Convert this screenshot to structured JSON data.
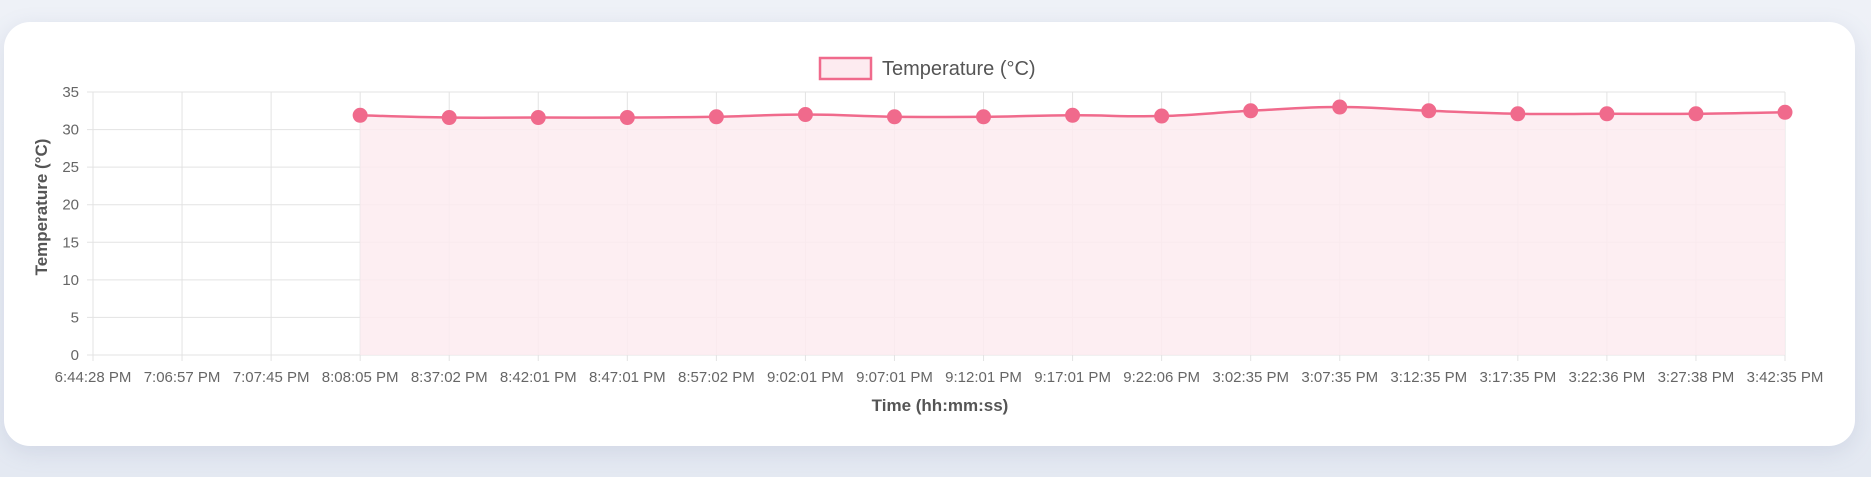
{
  "colors": {
    "line": "#f06a8c",
    "fill": "#fdebf0",
    "grid": "#e3e3e3",
    "point": "#f06a8c"
  },
  "chart_data": {
    "type": "line",
    "title": "",
    "xlabel": "Time (hh:mm:ss)",
    "ylabel": "Temperature (°C)",
    "ylim": [
      0,
      35
    ],
    "y_ticks": [
      "0",
      "5",
      "10",
      "15",
      "20",
      "25",
      "30",
      "35"
    ],
    "grid": true,
    "legend": {
      "position": "top",
      "entries": [
        "Temperature (°C)"
      ]
    },
    "categories": [
      "6:44:28 PM",
      "7:06:57 PM",
      "7:07:45 PM",
      "8:08:05 PM",
      "8:37:02 PM",
      "8:42:01 PM",
      "8:47:01 PM",
      "8:57:02 PM",
      "9:02:01 PM",
      "9:07:01 PM",
      "9:12:01 PM",
      "9:17:01 PM",
      "9:22:06 PM",
      "3:02:35 PM",
      "3:07:35 PM",
      "3:12:35 PM",
      "3:17:35 PM",
      "3:22:36 PM",
      "3:27:38 PM",
      "3:42:35 PM"
    ],
    "series": [
      {
        "name": "Temperature (°C)",
        "values": [
          null,
          null,
          null,
          31.9,
          31.6,
          31.6,
          31.6,
          31.7,
          32.0,
          31.7,
          31.7,
          31.9,
          31.8,
          32.5,
          33.0,
          32.5,
          32.1,
          32.1,
          32.1,
          32.3
        ]
      }
    ]
  }
}
